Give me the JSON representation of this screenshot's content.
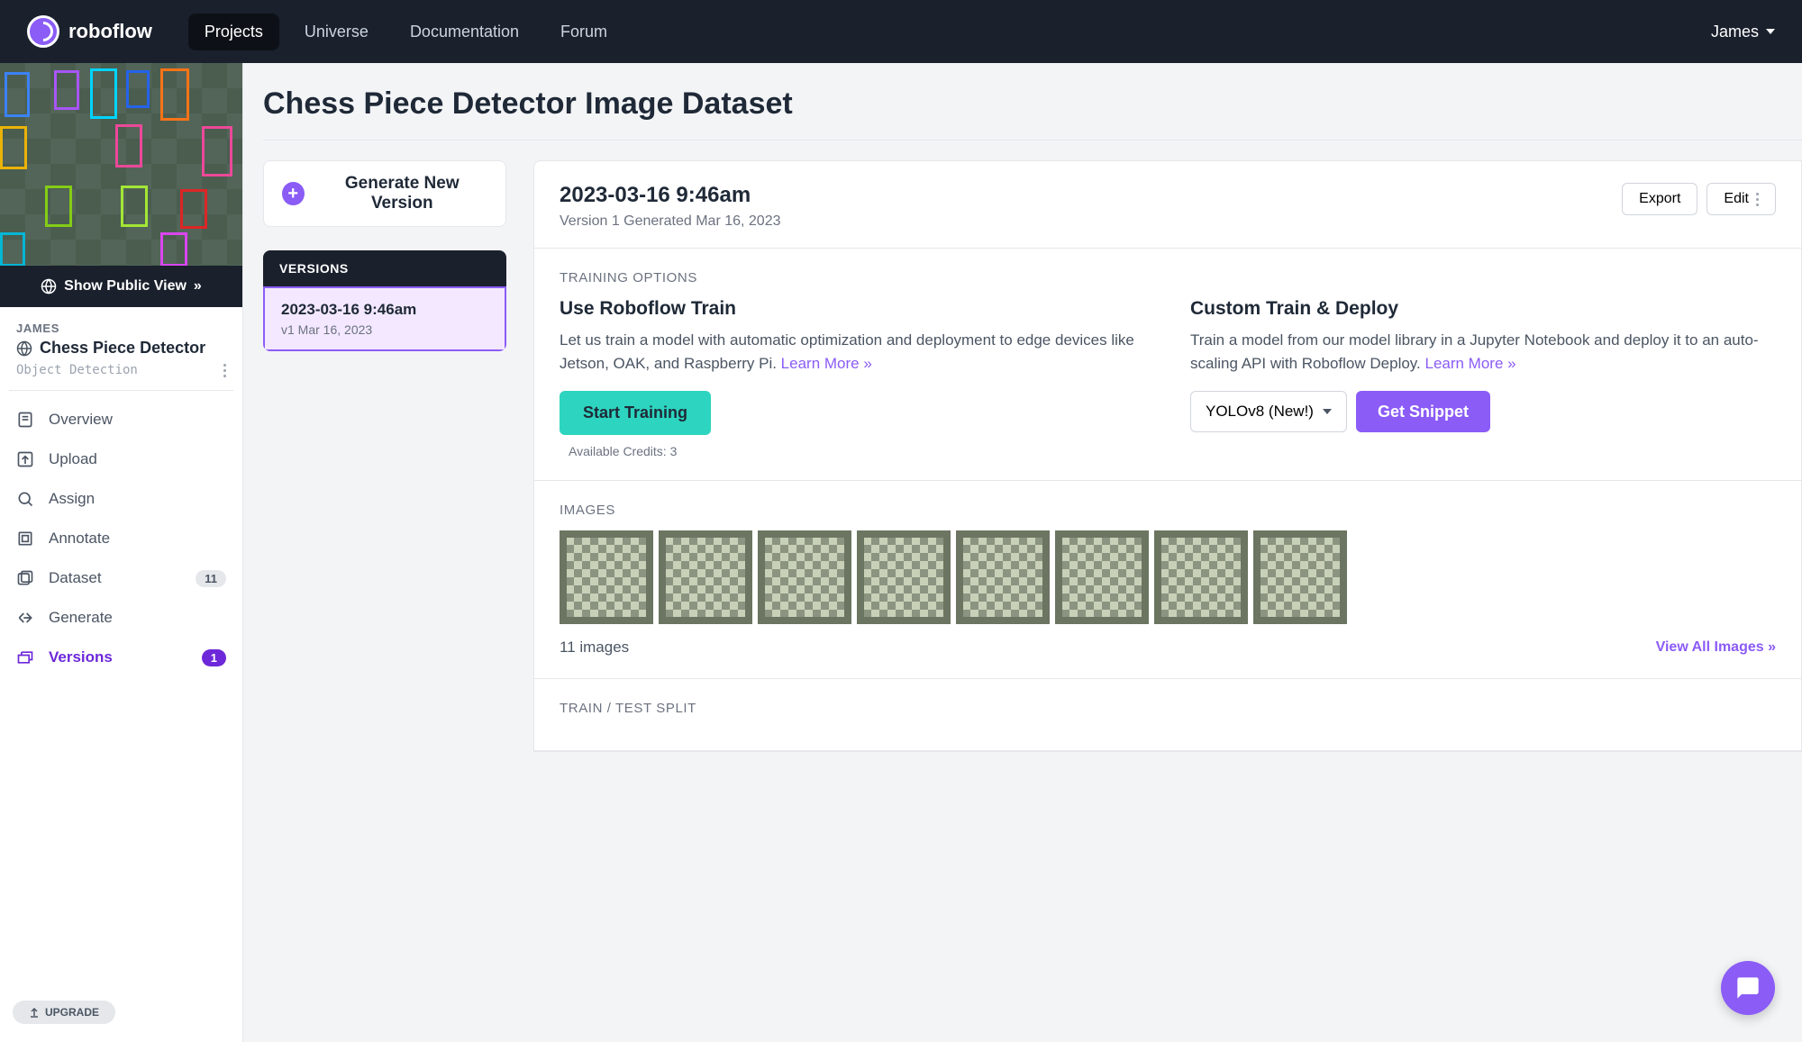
{
  "logo": "roboflow",
  "nav": {
    "links": [
      "Projects",
      "Universe",
      "Documentation",
      "Forum"
    ],
    "user": "James"
  },
  "sidebar": {
    "public_view": "Show Public View",
    "owner": "JAMES",
    "project_name": "Chess Piece Detector",
    "project_type": "Object Detection",
    "items": [
      {
        "label": "Overview"
      },
      {
        "label": "Upload"
      },
      {
        "label": "Assign"
      },
      {
        "label": "Annotate"
      },
      {
        "label": "Dataset",
        "badge": "11"
      },
      {
        "label": "Generate"
      },
      {
        "label": "Versions",
        "badge": "1",
        "active": true
      }
    ],
    "upgrade": "UPGRADE"
  },
  "page": {
    "title": "Chess Piece Detector Image Dataset",
    "generate_btn": "Generate New Version",
    "versions_header": "VERSIONS",
    "version": {
      "date": "2023-03-16 9:46am",
      "meta": "v1 Mar 16, 2023"
    }
  },
  "detail": {
    "title": "2023-03-16 9:46am",
    "subtitle": "Version 1 Generated Mar 16, 2023",
    "export": "Export",
    "edit": "Edit"
  },
  "training": {
    "label": "TRAINING OPTIONS",
    "roboflow": {
      "title": "Use Roboflow Train",
      "desc": "Let us train a model with automatic optimization and deployment to edge devices like Jetson, OAK, and Raspberry Pi. ",
      "learn": "Learn More »",
      "button": "Start Training",
      "credits": "Available Credits: 3"
    },
    "custom": {
      "title": "Custom Train & Deploy",
      "desc": "Train a model from our model library in a Jupyter Notebook and deploy it to an auto-scaling API with Roboflow Deploy. ",
      "learn": "Learn More »",
      "select": "YOLOv8 (New!)",
      "snippet": "Get Snippet"
    }
  },
  "images": {
    "label": "IMAGES",
    "count": "11 images",
    "view_all": "View All Images »"
  },
  "split": {
    "label": "TRAIN / TEST SPLIT"
  }
}
